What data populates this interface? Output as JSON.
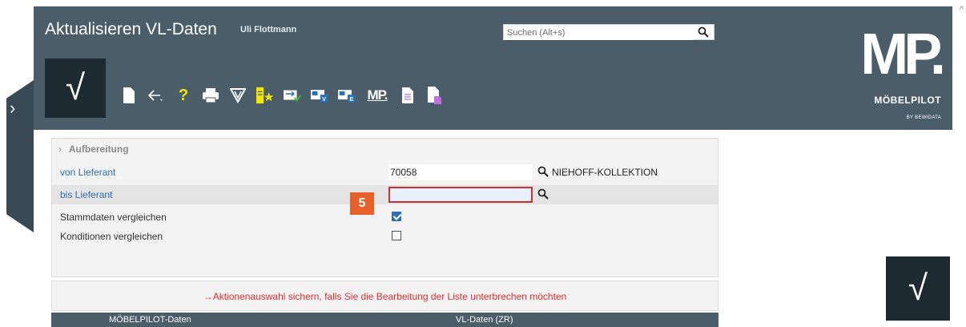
{
  "header": {
    "title": "Aktualisieren VL-Daten",
    "user": "Uli Flottmann",
    "search_placeholder": "Suchen (Alt+s)",
    "confirm_glyph": "√"
  },
  "toolbar": {
    "icons": [
      "new-document-icon",
      "back-icon",
      "help-icon",
      "print-icon",
      "filter-icon",
      "favorite-list-icon",
      "sync-icon",
      "import-v-icon",
      "import-e-icon",
      "mp-icon",
      "document-icon",
      "hand-document-icon"
    ],
    "help_glyph": "?",
    "mp_glyph": "MP."
  },
  "brand": {
    "logo": "MP.",
    "name": "MÖBELPILOT",
    "by": "BY BEWIDATA"
  },
  "form": {
    "section_title": "Aufbereitung",
    "von_lieferant_label": "von Lieferant",
    "von_lieferant_value": "70058",
    "von_lieferant_desc": "NIEHOFF-KOLLEKTION",
    "bis_lieferant_label": "bis Lieferant",
    "bis_lieferant_value": "",
    "stammdaten_label": "Stammdaten vergleichen",
    "stammdaten_checked": true,
    "konditionen_label": "Konditionen vergleichen",
    "konditionen_checked": false
  },
  "step_badge": "5",
  "notice": "→Aktionenauswahl sichern, falls Sie die Bearbeitung der Liste unterbrechen möchten",
  "table": {
    "col1": "MÖBELPILOT-Daten",
    "col2": "VL-Daten (ZR)"
  },
  "colors": {
    "header_bg": "#4a5d69",
    "tile_bg": "#1e2a32",
    "accent_orange": "#e8612a",
    "notice_red": "#e12c2c",
    "link_blue": "#2b6fb1"
  }
}
